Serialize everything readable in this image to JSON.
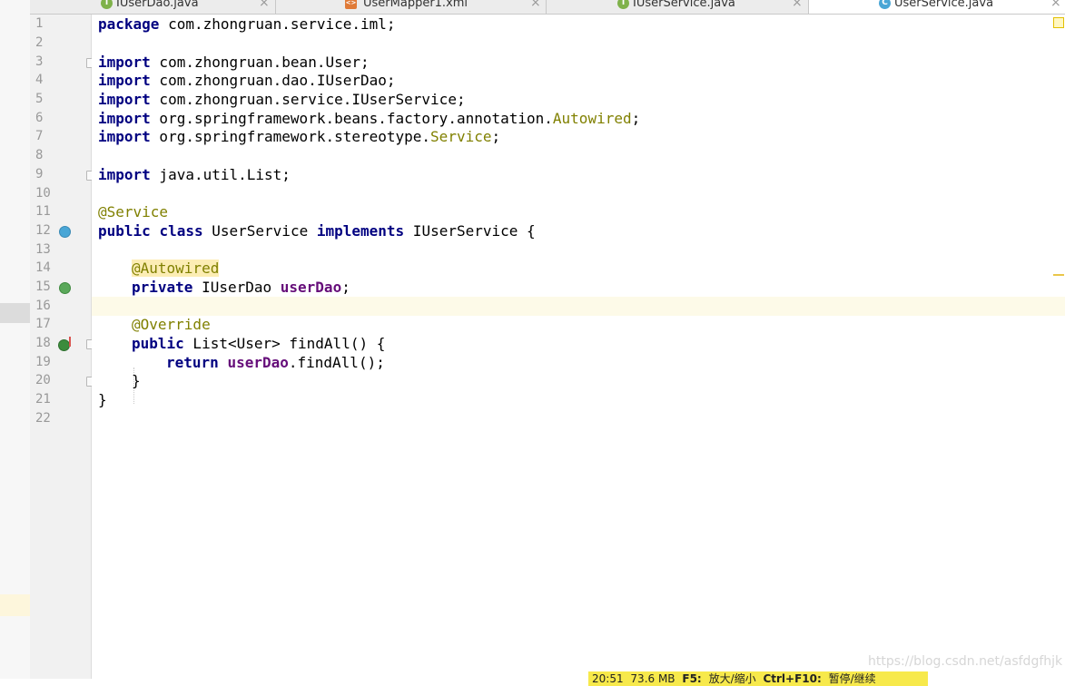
{
  "tabs": [
    {
      "label": "IUserDao.java",
      "icon": "interface-icon",
      "icon_letter": "I",
      "icon_color": "#7fb24a",
      "active": false
    },
    {
      "label": "UserMapper1.xml",
      "icon": "xml-file-icon",
      "icon_letter": "<>",
      "icon_color": "#e07b38",
      "active": false
    },
    {
      "label": "IUserService.java",
      "icon": "interface-icon",
      "icon_letter": "I",
      "icon_color": "#7fb24a",
      "active": false
    },
    {
      "label": "UserService.java",
      "icon": "class-icon",
      "icon_letter": "C",
      "icon_color": "#49a6d6",
      "active": true
    }
  ],
  "tab_close_glyph": "×",
  "line_numbers": [
    "1",
    "2",
    "3",
    "4",
    "5",
    "6",
    "7",
    "8",
    "9",
    "10",
    "11",
    "12",
    "13",
    "14",
    "15",
    "16",
    "17",
    "18",
    "19",
    "20",
    "21",
    "22"
  ],
  "code": {
    "l1": {
      "kw": "package",
      "rest": " com.zhongruan.service.iml;"
    },
    "l3": {
      "kw": "import",
      "rest": " com.zhongruan.bean.User;"
    },
    "l4": {
      "kw": "import",
      "rest": " com.zhongruan.dao.IUserDao;"
    },
    "l5": {
      "kw": "import",
      "rest": " com.zhongruan.service.IUserService;"
    },
    "l6": {
      "kw": "import",
      "rest": " org.springframework.beans.factory.annotation.",
      "ann": "Autowired",
      "end": ";"
    },
    "l7": {
      "kw": "import",
      "rest": " org.springframework.stereotype.",
      "ann": "Service",
      "end": ";"
    },
    "l9": {
      "kw": "import",
      "rest": " java.util.List;"
    },
    "l11": {
      "ann": "@Service"
    },
    "l12": {
      "kw1": "public",
      "kw2": "class",
      "name": " UserService ",
      "kw3": "implements",
      "rest": " IUserService {"
    },
    "l14": {
      "ann": "@Autowired"
    },
    "l15": {
      "kw": "private",
      "type": " IUserDao ",
      "field": "userDao",
      "end": ";"
    },
    "l17": {
      "ann": "@Override"
    },
    "l18": {
      "kw": "public",
      "rest": " List<User> findAll() {"
    },
    "l19": {
      "kw": "return",
      "field": "userDao",
      "rest": ".findAll();"
    },
    "l20": {
      "rest": "}"
    },
    "l21": {
      "rest": "}"
    }
  },
  "current_line": "16",
  "status": {
    "time": "20:51",
    "memory": "73.6 MB",
    "f5_key": "F5:",
    "f5_label": "放大/缩小",
    "ctrl_key": "Ctrl+F10:",
    "ctrl_label": "暂停/继续"
  },
  "watermark": "https://blog.csdn.net/asfdgfhjk",
  "colors": {
    "keyword": "#000080",
    "annotation": "#808000",
    "field": "#660e7a",
    "current_line_bg": "#fdfae8",
    "status_bg": "#f7e94b"
  }
}
